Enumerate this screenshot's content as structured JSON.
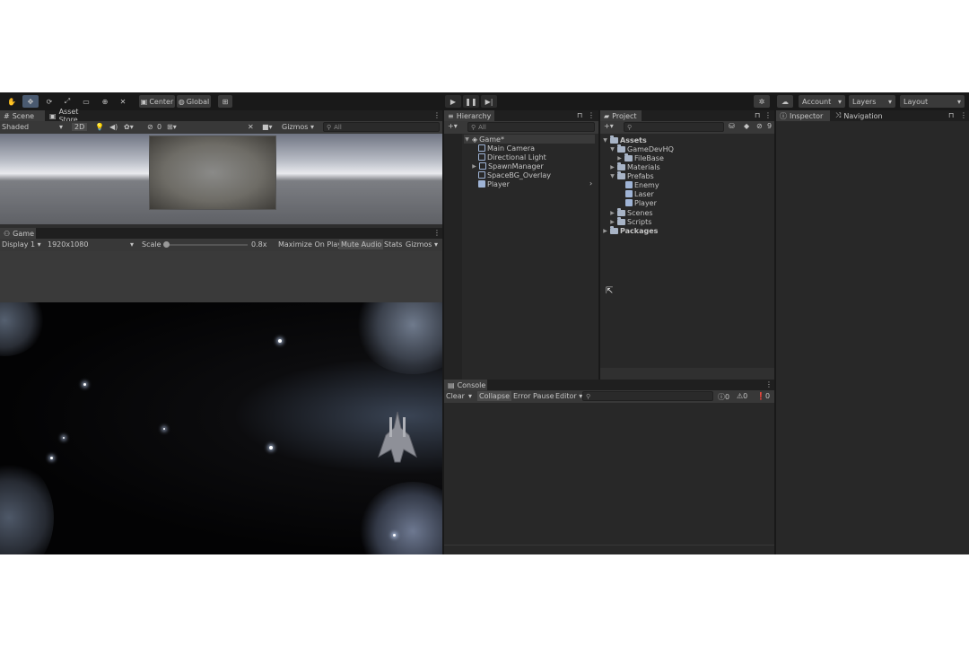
{
  "toolbar": {
    "center_label": "Center",
    "global_label": "Global",
    "account_label": "Account",
    "layers_label": "Layers",
    "layout_label": "Layout"
  },
  "scene": {
    "tab_scene": "Scene",
    "tab_asset_store": "Asset Store",
    "shading_mode": "Shaded",
    "mode_2d": "2D",
    "hidden_count": "0",
    "gizmos_label": "Gizmos",
    "search_placeholder": "All"
  },
  "game": {
    "tab_label": "Game",
    "display": "Display 1",
    "resolution": "1920x1080",
    "scale_label": "Scale",
    "scale_value": "0.8x",
    "maximize_label": "Maximize On Play",
    "mute_label": "Mute Audio",
    "stats_label": "Stats",
    "gizmos_label": "Gizmos"
  },
  "hierarchy": {
    "tab_label": "Hierarchy",
    "search_placeholder": "All",
    "items": [
      {
        "label": "Game*"
      },
      {
        "label": "Main Camera"
      },
      {
        "label": "Directional Light"
      },
      {
        "label": "SpawnManager"
      },
      {
        "label": "SpaceBG_Overlay"
      },
      {
        "label": "Player"
      }
    ]
  },
  "project": {
    "tab_label": "Project",
    "hidden_count": "9",
    "items": [
      {
        "label": "Assets"
      },
      {
        "label": "GameDevHQ"
      },
      {
        "label": "FileBase"
      },
      {
        "label": "Materials"
      },
      {
        "label": "Prefabs"
      },
      {
        "label": "Enemy"
      },
      {
        "label": "Laser"
      },
      {
        "label": "Player"
      },
      {
        "label": "Scenes"
      },
      {
        "label": "Scripts"
      },
      {
        "label": "Packages"
      }
    ]
  },
  "console": {
    "tab_label": "Console",
    "clear_label": "Clear",
    "collapse_label": "Collapse",
    "error_pause_label": "Error Pause",
    "editor_label": "Editor",
    "log_count": "0",
    "warning_count": "0",
    "error_count": "0"
  },
  "inspector": {
    "tab_label": "Inspector",
    "navigation_label": "Navigation"
  }
}
